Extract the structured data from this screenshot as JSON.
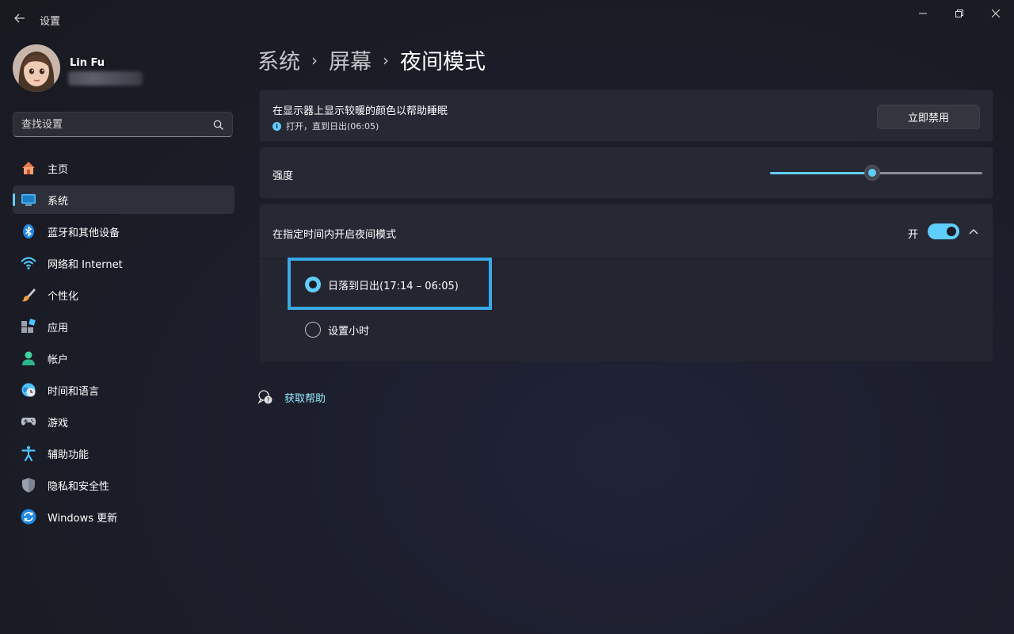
{
  "window": {
    "title": "设置",
    "controls": [
      "minimize",
      "maximize",
      "close"
    ]
  },
  "profile": {
    "name": "Lin Fu",
    "email_redacted": true
  },
  "search": {
    "placeholder": "查找设置"
  },
  "sidebar": {
    "items": [
      {
        "label": "主页",
        "icon": "home-icon",
        "selected": false
      },
      {
        "label": "系统",
        "icon": "system-display-icon",
        "selected": true
      },
      {
        "label": "蓝牙和其他设备",
        "icon": "bluetooth-icon",
        "selected": false
      },
      {
        "label": "网络和 Internet",
        "icon": "wifi-icon",
        "selected": false
      },
      {
        "label": "个性化",
        "icon": "paintbrush-icon",
        "selected": false
      },
      {
        "label": "应用",
        "icon": "apps-icon",
        "selected": false
      },
      {
        "label": "帐户",
        "icon": "account-icon",
        "selected": false
      },
      {
        "label": "时间和语言",
        "icon": "time-language-icon",
        "selected": false
      },
      {
        "label": "游戏",
        "icon": "gamepad-icon",
        "selected": false
      },
      {
        "label": "辅助功能",
        "icon": "accessibility-icon",
        "selected": false
      },
      {
        "label": "隐私和安全性",
        "icon": "shield-icon",
        "selected": false
      },
      {
        "label": "Windows 更新",
        "icon": "update-icon",
        "selected": false
      }
    ]
  },
  "breadcrumb": {
    "items": [
      "系统",
      "屏幕",
      "夜间模式"
    ],
    "separator": "›"
  },
  "night_light": {
    "description": "在显示器上显示较暖的颜色以帮助睡眠",
    "status": "打开，直到日出(06:05)",
    "disable_button": "立即禁用"
  },
  "strength": {
    "label": "强度",
    "value_percent": 48
  },
  "schedule": {
    "label": "在指定时间内开启夜间模式",
    "toggle_state": "开",
    "enabled": true,
    "expanded": true,
    "options": [
      {
        "label": "日落到日出(17:14 – 06:05)",
        "selected": true
      },
      {
        "label": "设置小时",
        "selected": false
      }
    ]
  },
  "help": {
    "label": "获取帮助"
  },
  "colors": {
    "accent": "#60cdff",
    "highlight_box": "#39a9e8",
    "card_bg": "#262834",
    "background": "#1a1b24"
  }
}
